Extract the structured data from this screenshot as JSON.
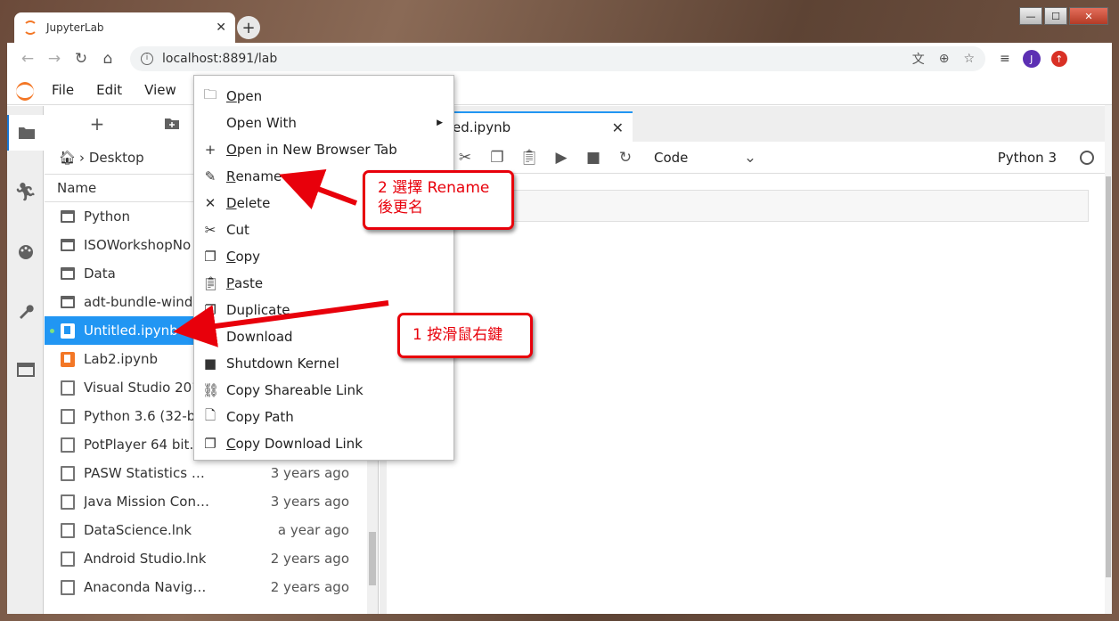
{
  "browser": {
    "tab_title": "JupyterLab",
    "tab_close": "✕",
    "new_tab": "+",
    "url": "localhost:8891/lab",
    "profile_initial": "J",
    "window_controls": [
      "—",
      "☐",
      "✕"
    ]
  },
  "jupyter": {
    "menus": [
      "File",
      "Edit",
      "View"
    ],
    "breadcrumb": "Desktop",
    "column_name": "Name",
    "files": [
      {
        "name": "Python",
        "modified": "",
        "icon": "folder-icon"
      },
      {
        "name": "ISOWorkshopNo",
        "modified": "",
        "icon": "folder-icon"
      },
      {
        "name": "Data",
        "modified": "",
        "icon": "folder-icon"
      },
      {
        "name": "adt-bundle-wind.",
        "modified": "",
        "icon": "folder-icon"
      },
      {
        "name": "Untitled.ipynb",
        "modified": "",
        "icon": "notebook-icon",
        "selected": true
      },
      {
        "name": "Lab2.ipynb",
        "modified": "",
        "icon": "notebook-icon"
      },
      {
        "name": "Visual Studio 201",
        "modified": "",
        "icon": "file-icon"
      },
      {
        "name": "Python 3.6 (32-bi",
        "modified": "",
        "icon": "file-icon"
      },
      {
        "name": "PotPlayer 64 bit.l",
        "modified": "",
        "icon": "file-icon"
      },
      {
        "name": "PASW Statistics 1...",
        "modified": "3 years ago",
        "icon": "file-icon"
      },
      {
        "name": "Java Mission Cont...",
        "modified": "3 years ago",
        "icon": "file-icon"
      },
      {
        "name": "DataScience.lnk",
        "modified": "a year ago",
        "icon": "file-icon"
      },
      {
        "name": "Android Studio.lnk",
        "modified": "2 years ago",
        "icon": "file-icon"
      },
      {
        "name": "Anaconda Naviga...",
        "modified": "2 years ago",
        "icon": "file-icon"
      }
    ],
    "notebook_tab": "ed.ipynb",
    "cell_type": "Code",
    "kernel": "Python 3"
  },
  "context_menu": [
    {
      "u": "O",
      "rest": "pen",
      "icon": "folder-icon"
    },
    {
      "u": "",
      "rest": "Open With",
      "icon": "",
      "submenu": true
    },
    {
      "u": "O",
      "rest": "pen in New Browser Tab",
      "icon": "plus-icon"
    },
    {
      "u": "R",
      "rest": "ename",
      "icon": "pencil-icon"
    },
    {
      "u": "D",
      "rest": "elete",
      "icon": "close-icon"
    },
    {
      "u": "",
      "rest": "Cut",
      "icon": "scissors-icon"
    },
    {
      "u": "C",
      "rest": "opy",
      "icon": "copy-icon"
    },
    {
      "u": "P",
      "rest": "aste",
      "icon": "paste-icon"
    },
    {
      "u": "",
      "rest": "Duplicate",
      "icon": "copy-icon"
    },
    {
      "u": "",
      "rest": "Download",
      "icon": "download-icon"
    },
    {
      "u": "",
      "rest": "Shutdown Kernel",
      "icon": "stop-icon"
    },
    {
      "u": "",
      "rest": "Copy Shareable Link",
      "icon": "link-icon"
    },
    {
      "u": "",
      "rest": "Copy Path",
      "icon": "file-icon"
    },
    {
      "u": "C",
      "rest": "opy Download Link",
      "icon": "copy-icon"
    }
  ],
  "annotations": {
    "step1": "1 按滑鼠右鍵",
    "step2_line1": "2 選擇 Rename",
    "step2_line2": "後更名",
    "color": "#e8000b"
  }
}
